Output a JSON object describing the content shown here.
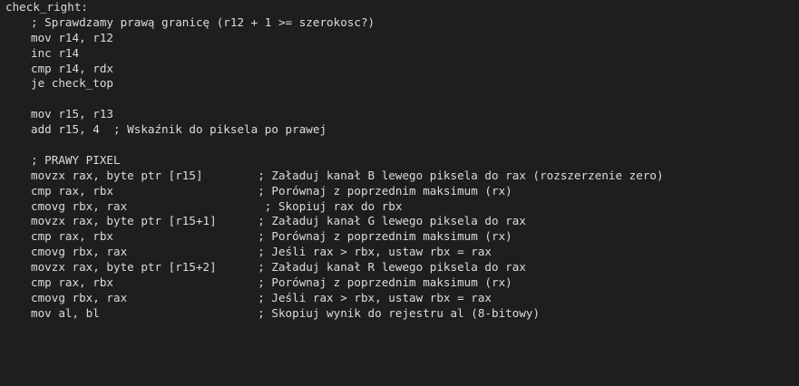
{
  "editor": {
    "background": "#1e1e1e",
    "text_color": "#dcdcdc",
    "lines": [
      {
        "code": "check_right:",
        "comment": "",
        "indent": false
      },
      {
        "code": "; Sprawdzamy prawą granicę (r12 + 1 >= szerokosc?)",
        "comment": "",
        "indent": true
      },
      {
        "code": "mov r14, r12",
        "comment": "",
        "indent": true
      },
      {
        "code": "inc r14",
        "comment": "",
        "indent": true
      },
      {
        "code": "cmp r14, rdx",
        "comment": "",
        "indent": true
      },
      {
        "code": "je check_top",
        "comment": "",
        "indent": true
      },
      {
        "code": "",
        "comment": "",
        "indent": false
      },
      {
        "code": "mov r15, r13",
        "comment": "",
        "indent": true
      },
      {
        "code": "add r15, 4  ; Wskaźnik do piksela po prawej",
        "comment": "",
        "indent": true
      },
      {
        "code": "",
        "comment": "",
        "indent": false
      },
      {
        "code": "; PRAWY PIXEL",
        "comment": "",
        "indent": true
      },
      {
        "code": "movzx rax, byte ptr [r15]        ",
        "comment": "; Załaduj kanał B lewego piksela do rax (rozszerzenie zero)",
        "indent": true
      },
      {
        "code": "cmp rax, rbx                     ",
        "comment": "; Porównaj z poprzednim maksimum (rx)",
        "indent": true
      },
      {
        "code": "cmovg rbx, rax                    ",
        "comment": "; Skopiuj rax do rbx",
        "indent": true
      },
      {
        "code": "movzx rax, byte ptr [r15+1]      ",
        "comment": "; Załaduj kanał G lewego piksela do rax",
        "indent": true
      },
      {
        "code": "cmp rax, rbx                     ",
        "comment": "; Porównaj z poprzednim maksimum (rx)",
        "indent": true
      },
      {
        "code": "cmovg rbx, rax                   ",
        "comment": "; Jeśli rax > rbx, ustaw rbx = rax",
        "indent": true
      },
      {
        "code": "movzx rax, byte ptr [r15+2]      ",
        "comment": "; Załaduj kanał R lewego piksela do rax",
        "indent": true
      },
      {
        "code": "cmp rax, rbx                     ",
        "comment": "; Porównaj z poprzednim maksimum (rx)",
        "indent": true
      },
      {
        "code": "cmovg rbx, rax                   ",
        "comment": "; Jeśli rax > rbx, ustaw rbx = rax",
        "indent": true
      },
      {
        "code": "mov al, bl                       ",
        "comment": "; Skopiuj wynik do rejestru al (8-bitowy)",
        "indent": true
      }
    ]
  }
}
